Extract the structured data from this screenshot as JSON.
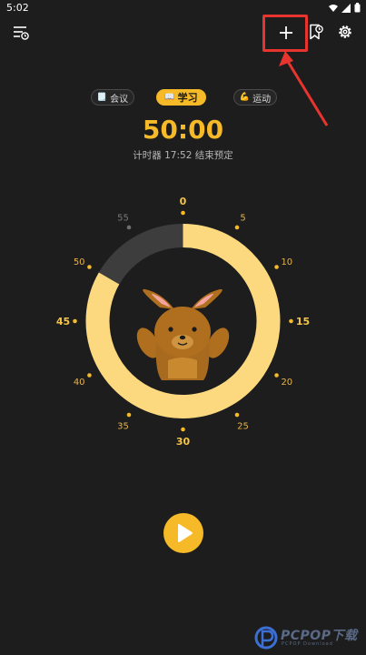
{
  "status_bar": {
    "time": "5:02"
  },
  "tabs": [
    {
      "label": "会议",
      "icon": "🗒️"
    },
    {
      "label": "学习",
      "icon": "📖"
    },
    {
      "label": "运动",
      "icon": "💪"
    }
  ],
  "timer": {
    "display": "50:00",
    "subtitle": "计时器 17:52 结束预定",
    "progress_fraction": 0.8333
  },
  "dial": {
    "ticks": [
      {
        "label": "0",
        "major": true
      },
      {
        "label": "5",
        "major": false
      },
      {
        "label": "10",
        "major": false
      },
      {
        "label": "15",
        "major": true
      },
      {
        "label": "20",
        "major": false
      },
      {
        "label": "25",
        "major": false
      },
      {
        "label": "30",
        "major": true
      },
      {
        "label": "35",
        "major": false
      },
      {
        "label": "40",
        "major": false
      },
      {
        "label": "45",
        "major": true
      },
      {
        "label": "50",
        "major": false
      },
      {
        "label": "55",
        "major": false,
        "dimmed": true
      }
    ]
  },
  "watermark": {
    "brand": "PCPOP下载",
    "sub": "PCPOP Download"
  },
  "colors": {
    "accent": "#f6b928",
    "ring_fill": "#fcd97e",
    "ring_empty": "#3d3d3d",
    "highlight": "#e8342e",
    "background": "#1d1d1d"
  }
}
